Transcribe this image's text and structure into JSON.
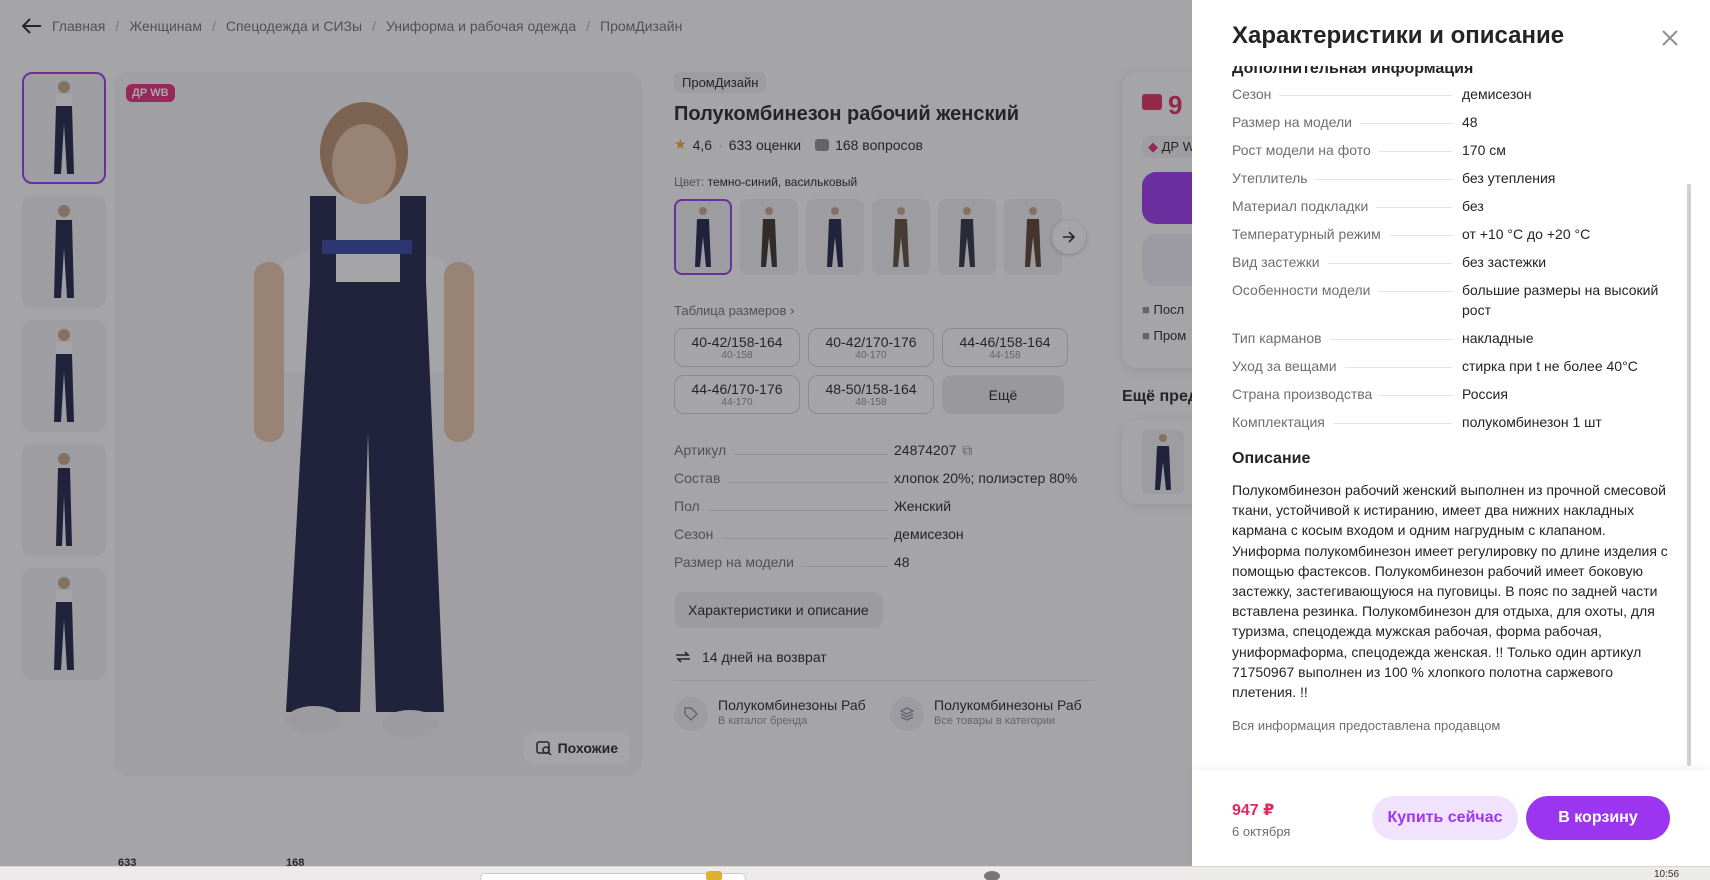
{
  "breadcrumbs": [
    "Главная",
    "Женщинам",
    "Спецодежда и СИЗы",
    "Униформа и рабочая одежда",
    "ПромДизайн"
  ],
  "gallery": {
    "badge": "ДР WB",
    "similar_label": "Похожие"
  },
  "product": {
    "brand": "ПромДизайн",
    "title": "Полукомбинезон рабочий женский",
    "rating": "4,6",
    "reviews": "633 оценки",
    "questions": "168 вопросов",
    "color_label": "Цвет:",
    "color_value": "темно-синий, васильковый",
    "size_table_label": "Таблица размеров",
    "sizes": [
      {
        "main": "40-42/158-164",
        "sub": "40-158"
      },
      {
        "main": "40-42/170-176",
        "sub": "40-170"
      },
      {
        "main": "44-46/158-164",
        "sub": "44-158"
      },
      {
        "main": "44-46/170-176",
        "sub": "44-170"
      },
      {
        "main": "48-50/158-164",
        "sub": "48-158"
      }
    ],
    "sizes_more": "Ещё",
    "params": [
      {
        "k": "Артикул",
        "v": "24874207"
      },
      {
        "k": "Состав",
        "v": "хлопок 20%; полиэстер 80%"
      },
      {
        "k": "Пол",
        "v": "Женский"
      },
      {
        "k": "Сезон",
        "v": "демисезон"
      },
      {
        "k": "Размер на модели",
        "v": "48"
      }
    ],
    "char_button": "Характеристики и описание",
    "returns": "14 дней на возврат",
    "links": [
      {
        "title": "Полукомбинезоны Раб",
        "sub": "В каталог бренда"
      },
      {
        "title": "Полукомбинезоны Раб",
        "sub": "Все товары в категории"
      }
    ]
  },
  "price_card": {
    "price_partial": "9",
    "dr_partial": "ДР W",
    "line1": "Посл",
    "line2": "Пром"
  },
  "more_title": "Ещё пред",
  "bottom_counts": [
    "633",
    "168"
  ],
  "panel": {
    "title": "Характеристики и описание",
    "subtitle_cut": "Дополнительная информация",
    "chars": [
      {
        "k": "Сезон",
        "v": "демисезон"
      },
      {
        "k": "Размер на модели",
        "v": "48"
      },
      {
        "k": "Рост модели на фото",
        "v": "170 см"
      },
      {
        "k": "Утеплитель",
        "v": "без утепления"
      },
      {
        "k": "Материал подкладки",
        "v": "без"
      },
      {
        "k": "Температурный режим",
        "v": "от +10 °C до +20 °C"
      },
      {
        "k": "Вид застежки",
        "v": "без застежки"
      },
      {
        "k": "Особенности модели",
        "v": "большие размеры на высокий рост"
      },
      {
        "k": "Тип карманов",
        "v": "накладные"
      },
      {
        "k": "Уход за вещами",
        "v": "стирка при t не более 40°С"
      },
      {
        "k": "Страна производства",
        "v": "Россия"
      },
      {
        "k": "Комплектация",
        "v": "полукомбинезон 1 шт"
      }
    ],
    "desc_title": "Описание",
    "description": "Полукомбинезон рабочий женский выполнен из прочной смесовой ткани, устойчивой к истиранию, имеет два нижних накладных кармана с косым входом и одним нагрудным с клапаном. Униформа полукомбинезон имеет регулировку по длине изделия с помощью фастексов. Полукомбинезон рабочий имеет боковую застежку, застегивающуюся на пуговицы. В пояс по задней части вставлена резинка. Полукомбинезон для отдыха, для охоты, для туризма, спецодежда мужская рабочая, форма рабочая, униформаформа, спецодежда женская. !! Только один артикул 71750967 выполнен из 100 % хлопкого полотна саржевого плетения. !!",
    "seller_note": "Вся информация предоставлена продавцом",
    "price": "947 ₽",
    "date": "6 октября",
    "buy_now": "Купить сейчас",
    "add_cart": "В корзину"
  },
  "taskbar": {
    "time": "10:56"
  },
  "colors": {
    "accent": "#9b35f0",
    "price": "#e02a5c",
    "badge": "#e6287a",
    "garment": "#1d1f45"
  }
}
